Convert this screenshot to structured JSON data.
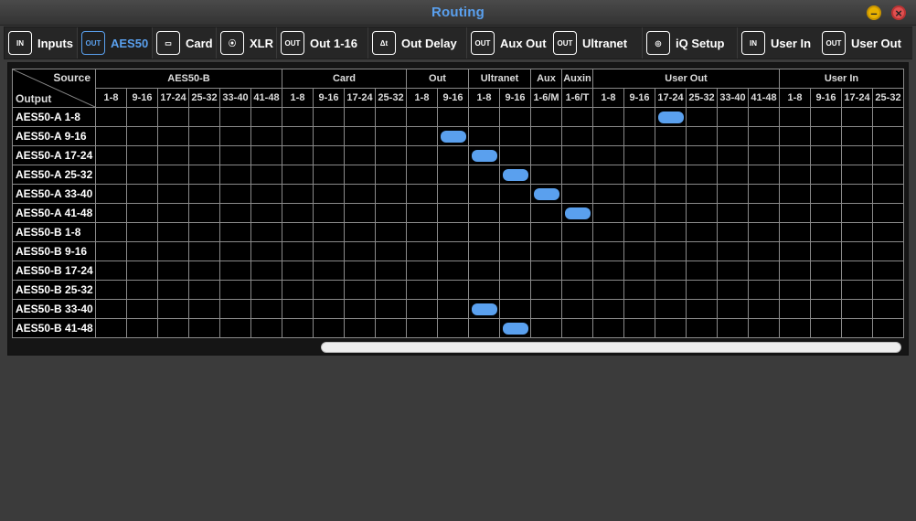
{
  "window": {
    "title": "Routing"
  },
  "tabs": [
    {
      "label": "Inputs",
      "icon": "input-icon",
      "icon_text": "IN",
      "active": false
    },
    {
      "label": "AES50",
      "icon": "output-icon",
      "icon_text": "OUT",
      "active": true
    },
    {
      "label": "Card",
      "icon": "card-icon",
      "icon_text": "▭",
      "active": false
    },
    {
      "label": "XLR",
      "icon": "xlr-icon",
      "icon_text": "⦿",
      "active": false
    },
    {
      "label": "Out 1-16",
      "icon": "output-icon",
      "icon_text": "OUT",
      "active": false
    },
    {
      "label": "Out Delay",
      "icon": "delay-icon",
      "icon_text": "Δt",
      "active": false
    },
    {
      "label": "Aux Out",
      "icon": "output-icon",
      "icon_text": "OUT",
      "active": false
    },
    {
      "label": "Ultranet",
      "icon": "output-icon",
      "icon_text": "OUT",
      "active": false
    },
    {
      "label": "iQ Setup",
      "icon": "speaker-icon",
      "icon_text": "◎",
      "active": false
    },
    {
      "label": "User In",
      "icon": "input-icon",
      "icon_text": "IN",
      "active": false
    },
    {
      "label": "User Out",
      "icon": "output-icon",
      "icon_text": "OUT",
      "active": false
    }
  ],
  "grid": {
    "corner_source": "Source",
    "corner_output": "Output",
    "groups": [
      {
        "label": "AES50-B",
        "columns": [
          "1-8",
          "9-16",
          "17-24",
          "25-32",
          "33-40",
          "41-48"
        ]
      },
      {
        "label": "Card",
        "columns": [
          "1-8",
          "9-16",
          "17-24",
          "25-32"
        ]
      },
      {
        "label": "Out",
        "columns": [
          "1-8",
          "9-16"
        ]
      },
      {
        "label": "Ultranet",
        "columns": [
          "1-8",
          "9-16"
        ]
      },
      {
        "label": "Aux",
        "columns": [
          "1-6/M"
        ]
      },
      {
        "label": "Auxin",
        "columns": [
          "1-6/T"
        ]
      },
      {
        "label": "User Out",
        "columns": [
          "1-8",
          "9-16",
          "17-24",
          "25-32",
          "33-40",
          "41-48"
        ]
      },
      {
        "label": "User In",
        "columns": [
          "1-8",
          "9-16",
          "17-24",
          "25-32"
        ]
      }
    ],
    "rows": [
      {
        "label": "AES50-A 1-8",
        "selected_col": 18
      },
      {
        "label": "AES50-A 9-16",
        "selected_col": 11
      },
      {
        "label": "AES50-A 17-24",
        "selected_col": 12
      },
      {
        "label": "AES50-A 25-32",
        "selected_col": 13
      },
      {
        "label": "AES50-A 33-40",
        "selected_col": 14
      },
      {
        "label": "AES50-A 41-48",
        "selected_col": 15
      },
      {
        "label": "AES50-B 1-8",
        "selected_col": null
      },
      {
        "label": "AES50-B 9-16",
        "selected_col": null
      },
      {
        "label": "AES50-B 17-24",
        "selected_col": null
      },
      {
        "label": "AES50-B 25-32",
        "selected_col": null
      },
      {
        "label": "AES50-B 33-40",
        "selected_col": 12
      },
      {
        "label": "AES50-B 41-48",
        "selected_col": 13
      }
    ]
  },
  "colors": {
    "accent": "#5aa0ee",
    "minimize": "#e8b100",
    "close": "#e05050"
  }
}
